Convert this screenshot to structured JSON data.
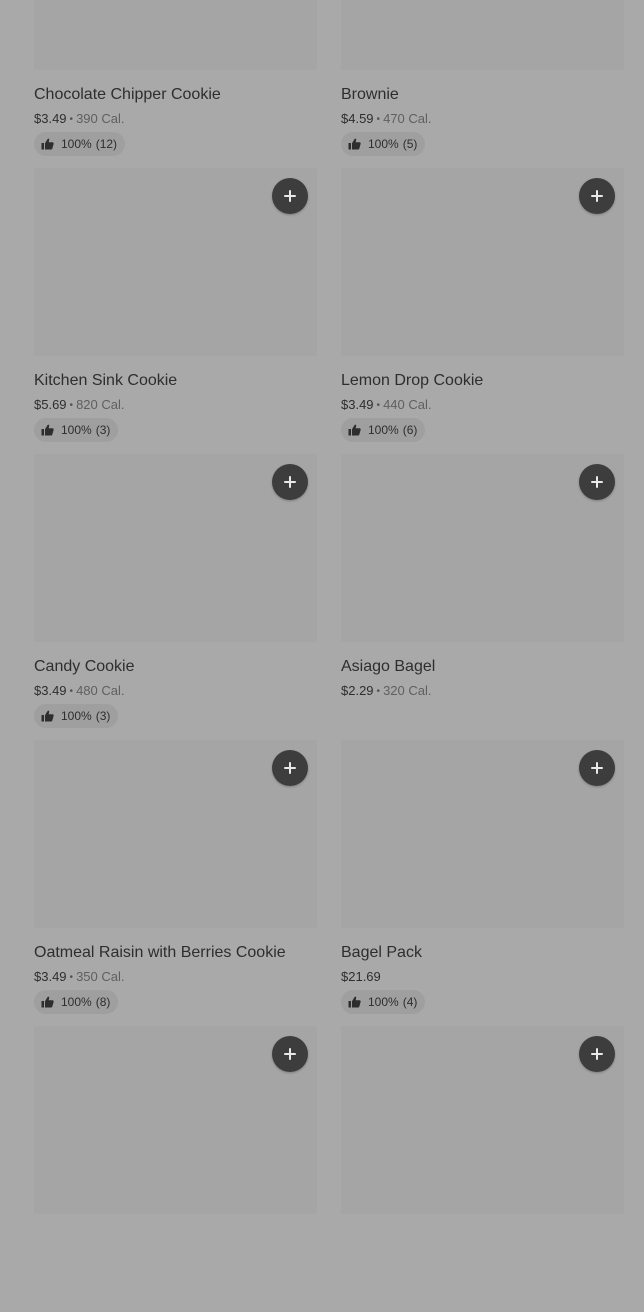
{
  "items": [
    {
      "name": "Chocolate Chipper Cookie",
      "price": "$3.49",
      "cal": "390 Cal.",
      "rating": "100%",
      "count": "(12)"
    },
    {
      "name": "Brownie",
      "price": "$4.59",
      "cal": "470 Cal.",
      "rating": "100%",
      "count": "(5)"
    },
    {
      "name": "Kitchen Sink Cookie",
      "price": "$5.69",
      "cal": "820 Cal.",
      "rating": "100%",
      "count": "(3)"
    },
    {
      "name": "Lemon Drop Cookie",
      "price": "$3.49",
      "cal": "440 Cal.",
      "rating": "100%",
      "count": "(6)"
    },
    {
      "name": "Candy Cookie",
      "price": "$3.49",
      "cal": "480 Cal.",
      "rating": "100%",
      "count": "(3)"
    },
    {
      "name": "Asiago Bagel",
      "price": "$2.29",
      "cal": "320 Cal.",
      "rating": null,
      "count": null
    },
    {
      "name": "Oatmeal Raisin with Berries Cookie",
      "price": "$3.49",
      "cal": "350 Cal.",
      "rating": "100%",
      "count": "(8)"
    },
    {
      "name": "Bagel Pack",
      "price": "$21.69",
      "cal": null,
      "rating": "100%",
      "count": "(4)"
    },
    {
      "name": null,
      "price": null,
      "cal": null,
      "rating": null,
      "count": null
    },
    {
      "name": null,
      "price": null,
      "cal": null,
      "rating": null,
      "count": null
    }
  ],
  "icons": {
    "add": "plus-icon",
    "rating": "thumbs-up-icon"
  },
  "colors": {
    "add_button": "#3d3d3d",
    "rating_pill": "#9f9f9f",
    "thumbnail": "#a5a5a5"
  }
}
